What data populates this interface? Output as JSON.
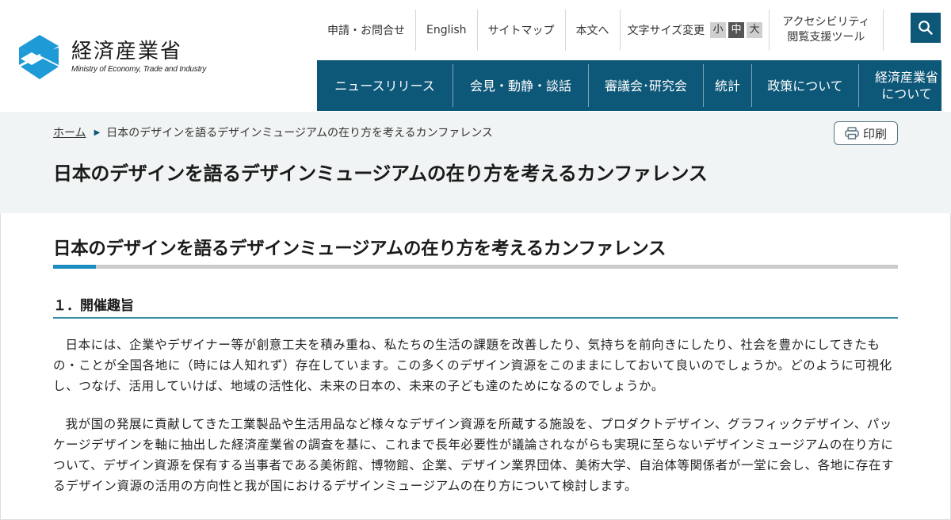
{
  "header": {
    "logo": {
      "name_jp": "経済産業省",
      "name_en": "Ministry of Economy, Trade and Industry",
      "icon": "meti-logo-icon",
      "color": "#1e9bd7"
    },
    "utility_nav": [
      {
        "label": "申請・お問合せ"
      },
      {
        "label": "English"
      },
      {
        "label": "サイトマップ"
      },
      {
        "label": "本文へ"
      }
    ],
    "font_size": {
      "label": "文字サイズ変更",
      "options": [
        "小",
        "中",
        "大"
      ],
      "selected": "中"
    },
    "accessibility": {
      "line1": "アクセシビリティ",
      "line2": "閲覧支援ツール"
    },
    "search": {
      "icon": "search-icon"
    },
    "main_nav": [
      {
        "label": "ニュースリリース"
      },
      {
        "label": "会見・動静・談話"
      },
      {
        "label": "審議会･研究会"
      },
      {
        "label": "統計"
      },
      {
        "label": "政策について"
      },
      {
        "label_line1": "経済産業省",
        "label_line2": "について"
      }
    ]
  },
  "title_band": {
    "breadcrumb": {
      "home": "ホーム",
      "separator": "▶",
      "current": "日本のデザインを語るデザインミュージアムの在り方を考えるカンファレンス"
    },
    "print_button": {
      "label": "印刷",
      "icon": "printer-icon"
    },
    "page_title": "日本のデザインを語るデザインミュージアムの在り方を考えるカンファレンス"
  },
  "content": {
    "heading": "日本のデザインを語るデザインミュージアムの在り方を考えるカンファレンス",
    "section1": {
      "heading": "１．開催趣旨",
      "paragraphs": [
        "日本には、企業やデザイナー等が創意工夫を積み重ね、私たちの生活の課題を改善したり、気持ちを前向きにしたり、社会を豊かにしてきたもの・ことが全国各地に（時には人知れず）存在しています。この多くのデザイン資源をこのままにしておいて良いのでしょうか。どのように可視化し、つなげ、活用していけば、地域の活性化、未来の日本の、未来の子ども達のためになるのでしょうか。",
        "我が国の発展に貢献してきた工業製品や生活用品など様々なデザイン資源を所蔵する施設を、プロダクトデザイン、グラフィックデザイン、パッケージデザインを軸に抽出した経済産業省の調査を基に、これまで長年必要性が議論されながらも実現に至らないデザインミュージアムの在り方について、デザイン資源を保有する当事者である美術館、博物館、企業、デザイン業界団体、美術大学、自治体等関係者が一堂に会し、各地に存在するデザイン資源の活用の方向性と我が国におけるデザインミュージアムの在り方について検討します。"
      ]
    }
  },
  "colors": {
    "brand_navy": "#0d5778",
    "accent_blue": "#1b8bc0",
    "title_band_bg": "#f1f4f4"
  }
}
